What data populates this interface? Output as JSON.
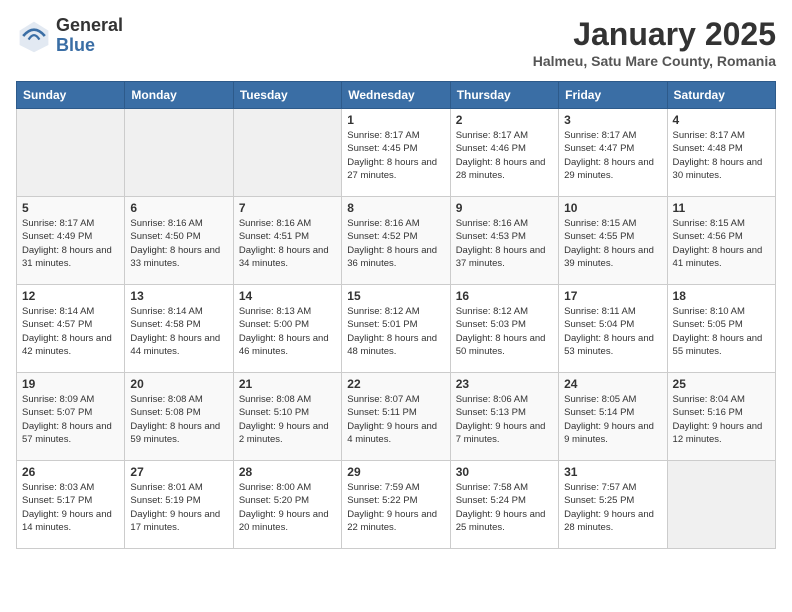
{
  "header": {
    "logo_general": "General",
    "logo_blue": "Blue",
    "month_title": "January 2025",
    "location": "Halmeu, Satu Mare County, Romania"
  },
  "days_of_week": [
    "Sunday",
    "Monday",
    "Tuesday",
    "Wednesday",
    "Thursday",
    "Friday",
    "Saturday"
  ],
  "weeks": [
    [
      {
        "day": "",
        "info": ""
      },
      {
        "day": "",
        "info": ""
      },
      {
        "day": "",
        "info": ""
      },
      {
        "day": "1",
        "info": "Sunrise: 8:17 AM\nSunset: 4:45 PM\nDaylight: 8 hours and 27 minutes."
      },
      {
        "day": "2",
        "info": "Sunrise: 8:17 AM\nSunset: 4:46 PM\nDaylight: 8 hours and 28 minutes."
      },
      {
        "day": "3",
        "info": "Sunrise: 8:17 AM\nSunset: 4:47 PM\nDaylight: 8 hours and 29 minutes."
      },
      {
        "day": "4",
        "info": "Sunrise: 8:17 AM\nSunset: 4:48 PM\nDaylight: 8 hours and 30 minutes."
      }
    ],
    [
      {
        "day": "5",
        "info": "Sunrise: 8:17 AM\nSunset: 4:49 PM\nDaylight: 8 hours and 31 minutes."
      },
      {
        "day": "6",
        "info": "Sunrise: 8:16 AM\nSunset: 4:50 PM\nDaylight: 8 hours and 33 minutes."
      },
      {
        "day": "7",
        "info": "Sunrise: 8:16 AM\nSunset: 4:51 PM\nDaylight: 8 hours and 34 minutes."
      },
      {
        "day": "8",
        "info": "Sunrise: 8:16 AM\nSunset: 4:52 PM\nDaylight: 8 hours and 36 minutes."
      },
      {
        "day": "9",
        "info": "Sunrise: 8:16 AM\nSunset: 4:53 PM\nDaylight: 8 hours and 37 minutes."
      },
      {
        "day": "10",
        "info": "Sunrise: 8:15 AM\nSunset: 4:55 PM\nDaylight: 8 hours and 39 minutes."
      },
      {
        "day": "11",
        "info": "Sunrise: 8:15 AM\nSunset: 4:56 PM\nDaylight: 8 hours and 41 minutes."
      }
    ],
    [
      {
        "day": "12",
        "info": "Sunrise: 8:14 AM\nSunset: 4:57 PM\nDaylight: 8 hours and 42 minutes."
      },
      {
        "day": "13",
        "info": "Sunrise: 8:14 AM\nSunset: 4:58 PM\nDaylight: 8 hours and 44 minutes."
      },
      {
        "day": "14",
        "info": "Sunrise: 8:13 AM\nSunset: 5:00 PM\nDaylight: 8 hours and 46 minutes."
      },
      {
        "day": "15",
        "info": "Sunrise: 8:12 AM\nSunset: 5:01 PM\nDaylight: 8 hours and 48 minutes."
      },
      {
        "day": "16",
        "info": "Sunrise: 8:12 AM\nSunset: 5:03 PM\nDaylight: 8 hours and 50 minutes."
      },
      {
        "day": "17",
        "info": "Sunrise: 8:11 AM\nSunset: 5:04 PM\nDaylight: 8 hours and 53 minutes."
      },
      {
        "day": "18",
        "info": "Sunrise: 8:10 AM\nSunset: 5:05 PM\nDaylight: 8 hours and 55 minutes."
      }
    ],
    [
      {
        "day": "19",
        "info": "Sunrise: 8:09 AM\nSunset: 5:07 PM\nDaylight: 8 hours and 57 minutes."
      },
      {
        "day": "20",
        "info": "Sunrise: 8:08 AM\nSunset: 5:08 PM\nDaylight: 8 hours and 59 minutes."
      },
      {
        "day": "21",
        "info": "Sunrise: 8:08 AM\nSunset: 5:10 PM\nDaylight: 9 hours and 2 minutes."
      },
      {
        "day": "22",
        "info": "Sunrise: 8:07 AM\nSunset: 5:11 PM\nDaylight: 9 hours and 4 minutes."
      },
      {
        "day": "23",
        "info": "Sunrise: 8:06 AM\nSunset: 5:13 PM\nDaylight: 9 hours and 7 minutes."
      },
      {
        "day": "24",
        "info": "Sunrise: 8:05 AM\nSunset: 5:14 PM\nDaylight: 9 hours and 9 minutes."
      },
      {
        "day": "25",
        "info": "Sunrise: 8:04 AM\nSunset: 5:16 PM\nDaylight: 9 hours and 12 minutes."
      }
    ],
    [
      {
        "day": "26",
        "info": "Sunrise: 8:03 AM\nSunset: 5:17 PM\nDaylight: 9 hours and 14 minutes."
      },
      {
        "day": "27",
        "info": "Sunrise: 8:01 AM\nSunset: 5:19 PM\nDaylight: 9 hours and 17 minutes."
      },
      {
        "day": "28",
        "info": "Sunrise: 8:00 AM\nSunset: 5:20 PM\nDaylight: 9 hours and 20 minutes."
      },
      {
        "day": "29",
        "info": "Sunrise: 7:59 AM\nSunset: 5:22 PM\nDaylight: 9 hours and 22 minutes."
      },
      {
        "day": "30",
        "info": "Sunrise: 7:58 AM\nSunset: 5:24 PM\nDaylight: 9 hours and 25 minutes."
      },
      {
        "day": "31",
        "info": "Sunrise: 7:57 AM\nSunset: 5:25 PM\nDaylight: 9 hours and 28 minutes."
      },
      {
        "day": "",
        "info": ""
      }
    ]
  ]
}
